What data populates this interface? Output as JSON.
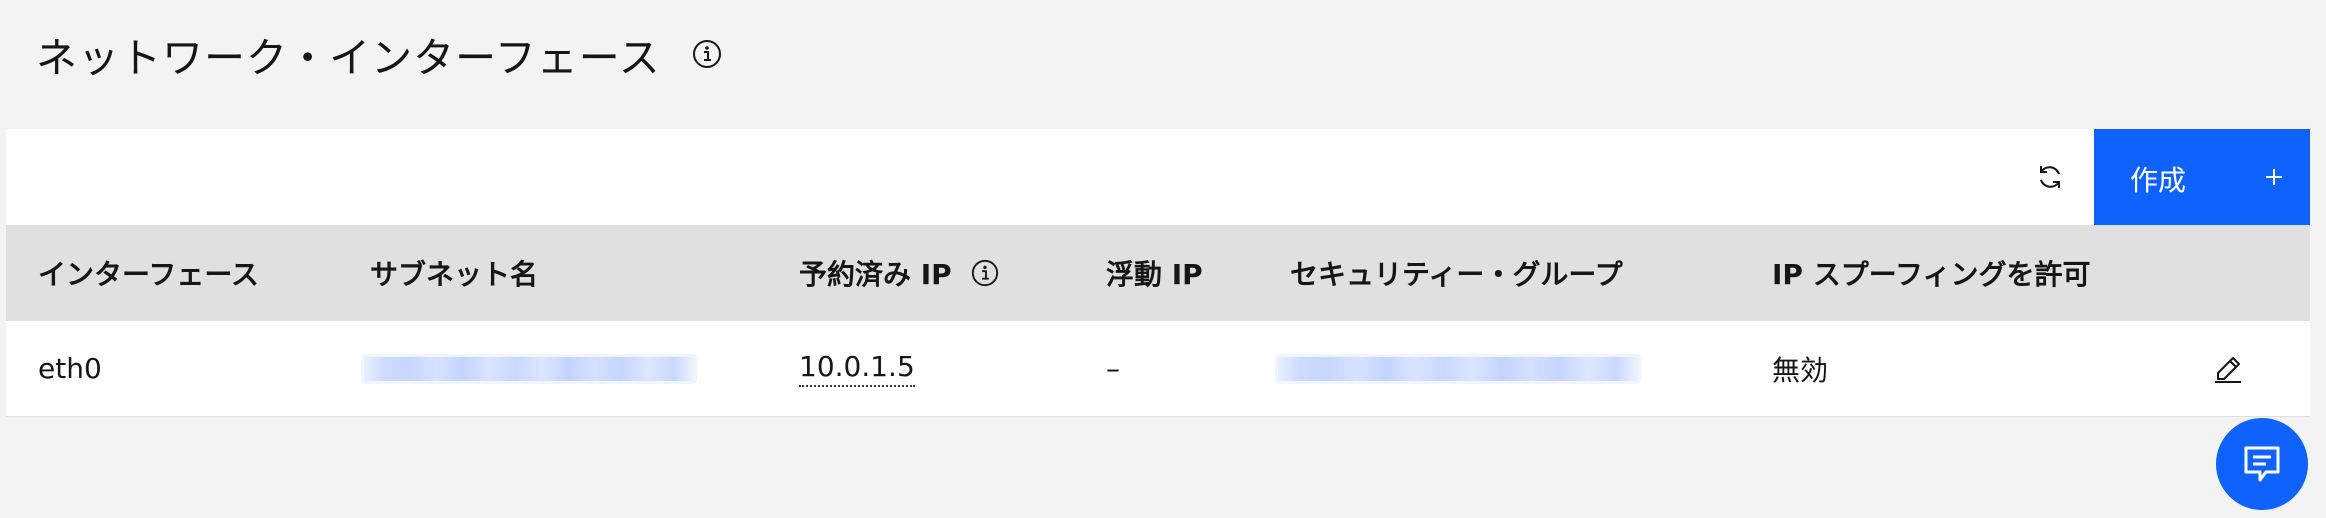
{
  "header": {
    "title": "ネットワーク・インターフェース",
    "info_icon": "info-icon"
  },
  "toolbar": {
    "refresh_icon": "refresh-icon",
    "create_label": "作成",
    "create_icon": "plus-icon"
  },
  "table": {
    "columns": [
      "インターフェース",
      "サブネット名",
      "予約済み IP",
      "浮動 IP",
      "セキュリティー・グループ",
      "IP スプーフィングを許可"
    ],
    "reserved_ip_info_icon": "info-icon",
    "rows": [
      {
        "interface": "eth0",
        "subnet_name": "",
        "reserved_ip": "10.0.1.5",
        "floating_ip": "–",
        "security_group": "",
        "ip_spoofing": "無効",
        "edit_icon": "edit-icon"
      }
    ]
  },
  "colors": {
    "primary": "#0f62fe",
    "page_background": "#f3f3f3",
    "header_row_background": "#e0e0e0",
    "blurred_link_tint": "#c6d7ff"
  },
  "floating": {
    "chat_icon": "chat-icon"
  }
}
